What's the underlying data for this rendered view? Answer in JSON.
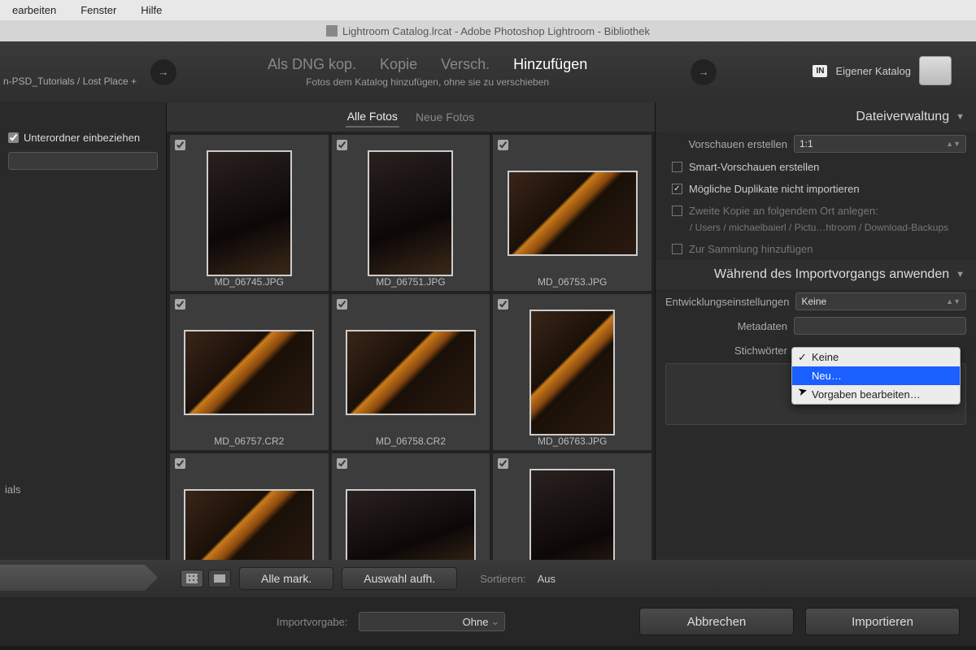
{
  "menubar": {
    "items": [
      "earbeiten",
      "Fenster",
      "Hilfe"
    ]
  },
  "titlebar": {
    "text": "Lightroom Catalog.lrcat - Adobe Photoshop Lightroom - Bibliothek"
  },
  "topshelf": {
    "breadcrumb": "n-PSD_Tutorials / Lost Place +",
    "modes": [
      "Als DNG kop.",
      "Kopie",
      "Versch.",
      "Hinzufügen"
    ],
    "active_mode": "Hinzufügen",
    "subtitle": "Fotos dem Katalog hinzufügen, ohne sie zu verschieben",
    "dest_badge": "IN",
    "dest_label": "Eigener Katalog"
  },
  "leftpanel": {
    "include_subfolders": "Unterordner einbeziehen",
    "ials": "ials"
  },
  "tabs": {
    "all": "Alle Fotos",
    "new": "Neue Fotos",
    "active": "all"
  },
  "thumbs": [
    {
      "name": "MD_06745.JPG",
      "orient": "portrait",
      "variant": "dark"
    },
    {
      "name": "MD_06751.JPG",
      "orient": "portrait",
      "variant": "dark"
    },
    {
      "name": "MD_06753.JPG",
      "orient": "landscape",
      "variant": "fire"
    },
    {
      "name": "MD_06757.CR2",
      "orient": "landscape",
      "variant": "fire"
    },
    {
      "name": "MD_06758.CR2",
      "orient": "landscape",
      "variant": "fire"
    },
    {
      "name": "MD_06763.JPG",
      "orient": "portrait",
      "variant": "fire"
    },
    {
      "name": "",
      "orient": "landscape",
      "variant": "fire"
    },
    {
      "name": "",
      "orient": "landscape",
      "variant": "dark"
    },
    {
      "name": "",
      "orient": "portrait",
      "variant": "dark"
    }
  ],
  "rightpanel": {
    "file_handling_hdr": "Dateiverwaltung",
    "build_previews_lbl": "Vorschauen erstellen",
    "build_previews_val": "1:1",
    "smart_previews": "Smart-Vorschauen erstellen",
    "no_duplicates": "Mögliche Duplikate nicht importieren",
    "second_copy": "Zweite Kopie an folgendem Ort anlegen:",
    "second_copy_path": "/ Users / michaelbaierl / Pictu…htroom / Download-Backups",
    "add_to_collection": "Zur Sammlung hinzufügen",
    "apply_during_hdr": "Während des Importvorgangs anwenden",
    "develop_label": "Entwicklungseinstellungen",
    "develop_value": "Keine",
    "metadata_label": "Metadaten",
    "keywords_label": "Stichwörter",
    "menu": {
      "keine": "Keine",
      "neu": "Neu…",
      "edit": "Vorgaben bearbeiten…"
    }
  },
  "toolbar": {
    "check_all": "Alle mark.",
    "uncheck_all": "Auswahl aufh.",
    "sort_lbl": "Sortieren:",
    "sort_val": "Aus"
  },
  "footer": {
    "preset_lbl": "Importvorgabe:",
    "preset_val": "Ohne",
    "cancel": "Abbrechen",
    "import": "Importieren"
  }
}
